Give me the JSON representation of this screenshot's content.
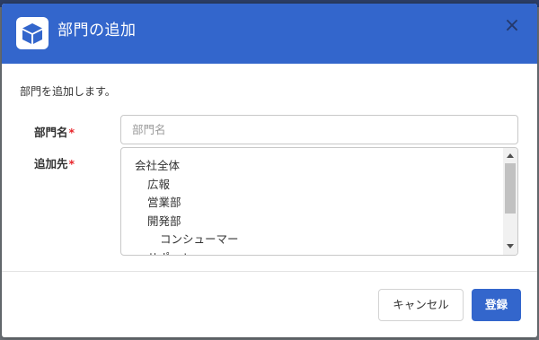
{
  "dialog": {
    "title": "部門の追加",
    "close_label": "×",
    "header_icon": "cube-icon",
    "description": "部門を追加します。",
    "accent_color": "#3366cc",
    "required_color": "#e8262c"
  },
  "form": {
    "name_label": "部門名",
    "name_placeholder": "部門名",
    "name_value": "",
    "parent_label": "追加先",
    "required_mark": "*",
    "parent_options": [
      {
        "label": "会社全体",
        "level": 0
      },
      {
        "label": "広報",
        "level": 1
      },
      {
        "label": "営業部",
        "level": 1
      },
      {
        "label": "開発部",
        "level": 1
      },
      {
        "label": "コンシューマー",
        "level": 2
      },
      {
        "label": "サポート",
        "level": 1
      }
    ]
  },
  "footer": {
    "cancel_label": "キャンセル",
    "submit_label": "登録"
  }
}
